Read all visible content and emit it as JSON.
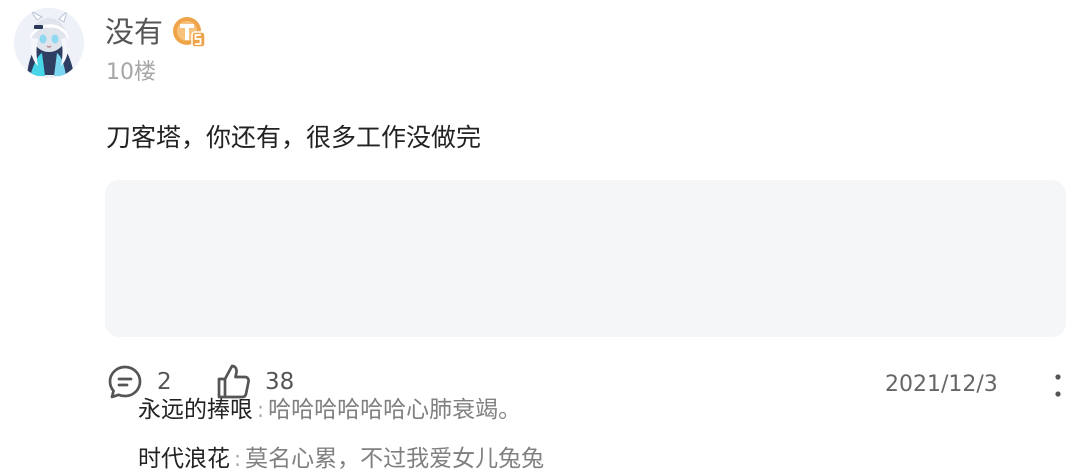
{
  "post": {
    "username": "没有",
    "level_badge": "T5",
    "floor": "10楼",
    "content": "刀客塔，你还有，很多工作没做完",
    "date": "2021/12/3"
  },
  "replies": [
    {
      "author": "永远的捧哏",
      "separator": ":",
      "text": "哈哈哈哈哈哈心肺衰竭。"
    },
    {
      "author": "时代浪花",
      "separator": ":",
      "text": "莫名心累，不过我爱女儿兔兔"
    }
  ],
  "actions": {
    "comment_count": "2",
    "like_count": "38"
  },
  "icons": {
    "avatar": "anime-character-avatar",
    "level_badge": "level-badge-icon",
    "comment": "comment-bubble-icon",
    "like": "thumbs-up-icon",
    "more": "vertical-dots-icon"
  },
  "colors": {
    "badge": "#f0a44a",
    "reply_panel": "#f5f6f7",
    "muted_text": "#a6a6a6"
  }
}
